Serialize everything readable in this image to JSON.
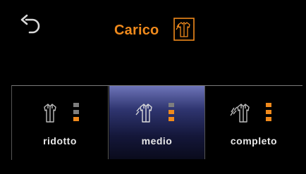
{
  "header": {
    "title": "Carico",
    "title_icon": "laundry-load-icon",
    "back_icon": "back-arrow-icon"
  },
  "options": [
    {
      "id": "ridotto",
      "label": "ridotto",
      "icon": "single-shirt-icon",
      "level": 1,
      "level_max": 3,
      "selected": false
    },
    {
      "id": "medio",
      "label": "medio",
      "icon": "double-shirt-icon",
      "level": 2,
      "level_max": 3,
      "selected": true
    },
    {
      "id": "completo",
      "label": "completo",
      "icon": "triple-shirt-icon",
      "level": 3,
      "level_max": 3,
      "selected": false
    }
  ],
  "colors": {
    "accent": "#f08a1c",
    "level_off": "#7e7e7e",
    "selected_bg_top": "#6d74b8",
    "selected_bg_bottom": "#0a0b1c"
  }
}
